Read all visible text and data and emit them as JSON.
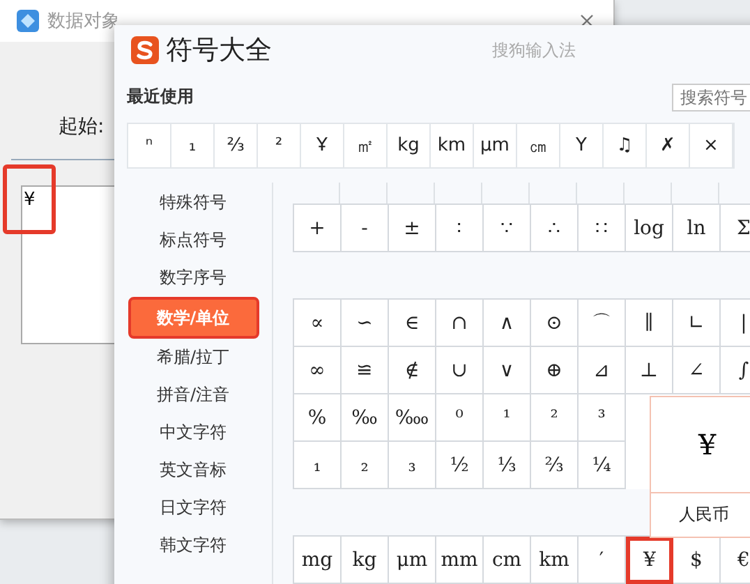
{
  "background_window": {
    "title": "数据对象",
    "start_label": "起始:",
    "text_value": "¥",
    "text_marked": true
  },
  "symbol_panel": {
    "title": "符号大全",
    "brand": "搜狗输入法",
    "recent_label": "最近使用",
    "search": {
      "placeholder": "搜索符号"
    },
    "recent": [
      "ⁿ",
      "₁",
      "⅔",
      "²",
      "Ұ",
      "㎡",
      "kg",
      "km",
      "μm",
      "㎝",
      "Y",
      "♫",
      "✗",
      "×"
    ],
    "categories": [
      {
        "label": "特殊符号",
        "selected": false
      },
      {
        "label": "标点符号",
        "selected": false
      },
      {
        "label": "数字序号",
        "selected": false
      },
      {
        "label": "数学/单位",
        "selected": true
      },
      {
        "label": "希腊/拉丁",
        "selected": false
      },
      {
        "label": "拼音/注音",
        "selected": false
      },
      {
        "label": "中文字符",
        "selected": false
      },
      {
        "label": "英文音标",
        "selected": false
      },
      {
        "label": "日文字符",
        "selected": false
      },
      {
        "label": "韩文字符",
        "selected": false
      }
    ],
    "groups": [
      {
        "rows": [
          [
            "+",
            "-",
            "±",
            "∶",
            "∵",
            "∴",
            "∷",
            "log",
            "ln",
            "Σ"
          ]
        ]
      },
      {
        "rows": [
          [
            "∝",
            "∽",
            "∈",
            "∩",
            "∧",
            "⊙",
            "⌒",
            "∥",
            "∟",
            "|"
          ],
          [
            "∞",
            "≌",
            "∉",
            "∪",
            "∨",
            "⊕",
            "⊿",
            "⊥",
            "∠",
            "∫"
          ],
          [
            "%",
            "‰",
            "‱",
            "⁰",
            "¹",
            "²",
            "³"
          ],
          [
            "₁",
            "₂",
            "₃",
            "½",
            "⅓",
            "⅔",
            "¼"
          ]
        ]
      }
    ],
    "unit_row": [
      {
        "symbol": "mg",
        "marked": false
      },
      {
        "symbol": "kg",
        "marked": false
      },
      {
        "symbol": "μm",
        "marked": false
      },
      {
        "symbol": "mm",
        "marked": false
      },
      {
        "symbol": "cm",
        "marked": false
      },
      {
        "symbol": "km",
        "marked": false
      },
      {
        "symbol": "′",
        "marked": false
      },
      {
        "symbol": "¥",
        "marked": true
      },
      {
        "symbol": "$",
        "marked": false
      },
      {
        "symbol": "€",
        "marked": false
      }
    ],
    "preview": {
      "symbol": "¥",
      "name": "人民币"
    }
  }
}
